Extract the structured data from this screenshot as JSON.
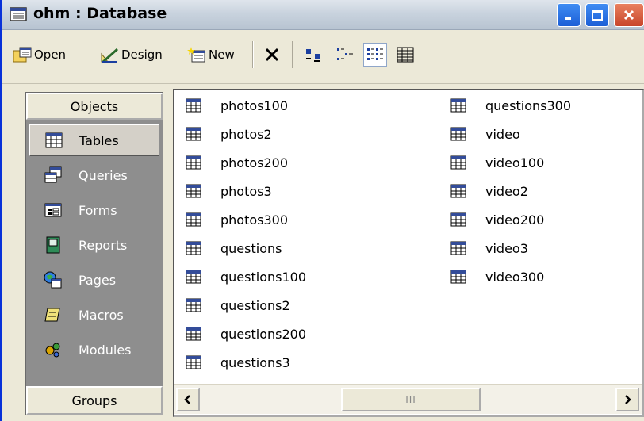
{
  "window": {
    "title": "ohm : Database"
  },
  "toolbar": {
    "open_label": "Open",
    "design_label": "Design",
    "new_label": "New"
  },
  "objects": {
    "header": "Objects",
    "footer": "Groups",
    "items": [
      {
        "label": "Tables",
        "icon": "table-icon",
        "selected": true
      },
      {
        "label": "Queries",
        "icon": "query-icon",
        "selected": false
      },
      {
        "label": "Forms",
        "icon": "form-icon",
        "selected": false
      },
      {
        "label": "Reports",
        "icon": "report-icon",
        "selected": false
      },
      {
        "label": "Pages",
        "icon": "page-icon",
        "selected": false
      },
      {
        "label": "Macros",
        "icon": "macro-icon",
        "selected": false
      },
      {
        "label": "Modules",
        "icon": "module-icon",
        "selected": false
      }
    ]
  },
  "tables": {
    "col1": [
      "photos100",
      "photos2",
      "photos200",
      "photos3",
      "photos300",
      "questions",
      "questions100",
      "questions2",
      "questions200",
      "questions3"
    ],
    "col2": [
      "questions300",
      "video",
      "video100",
      "video2",
      "video200",
      "video3",
      "video300"
    ]
  },
  "scrollbar": {
    "thumb_grip": "III"
  },
  "colors": {
    "objects_bar_bg": "#8e8e8e",
    "title_bar_bg": "#c9d3de",
    "close_button": "#c8452a"
  }
}
